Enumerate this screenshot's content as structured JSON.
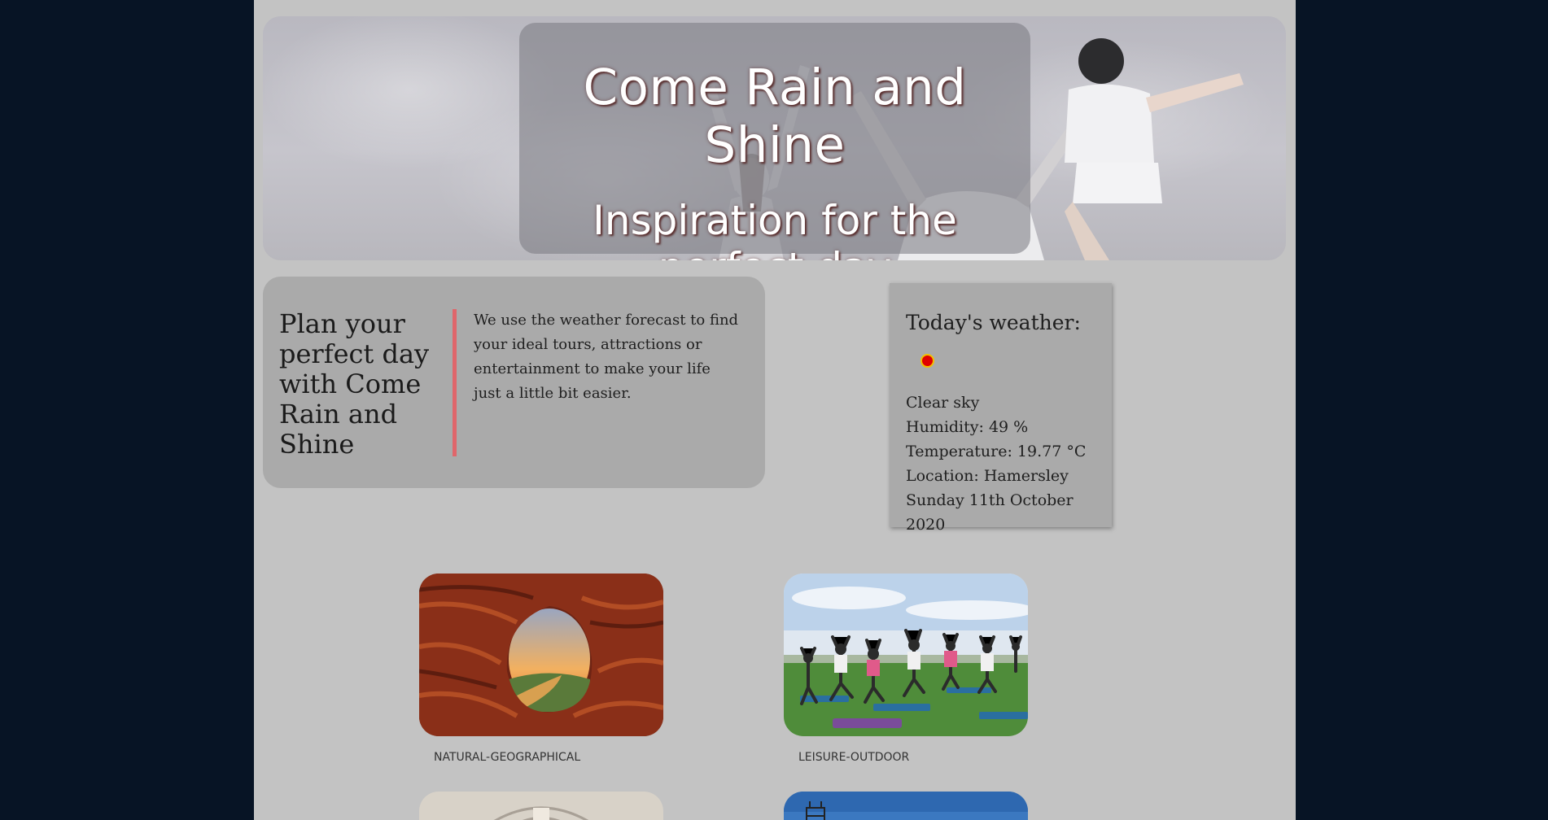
{
  "hero": {
    "title": "Come Rain and Shine",
    "subtitle": "Inspiration for the perfect day"
  },
  "intro": {
    "heading": "Plan your perfect day with Come Rain and Shine",
    "body": "We use the weather forecast to find your ideal tours, attractions or entertainment to make your life just a little bit easier.",
    "accent_color": "#e0666b"
  },
  "weather": {
    "title": "Today's weather:",
    "icon": "clear-sky-sun-icon",
    "description": "Clear sky",
    "humidity": "Humidity: 49 %",
    "temperature": "Temperature: 19.77 °C",
    "location": "Location: Hamersley",
    "date": "Sunday 11th October 2020"
  },
  "gallery": [
    {
      "category": "NATURAL-GEOGRAPHICAL",
      "image": "gorge-window-landscape-photo"
    },
    {
      "category": "LEISURE-OUTDOOR",
      "image": "outdoor-yoga-class-photo"
    },
    {
      "category": "",
      "image": "building-interior-photo"
    },
    {
      "category": "",
      "image": "outdoor-structure-photo"
    }
  ],
  "colors": {
    "outer_background": "#071425",
    "page_background": "#c3c3c3",
    "card_background": "#aaaaaa"
  }
}
